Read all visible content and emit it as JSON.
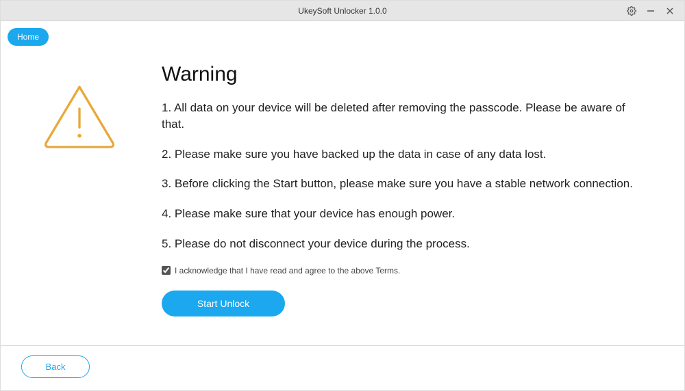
{
  "titlebar": {
    "title": "UkeySoft Unlocker 1.0.0"
  },
  "nav": {
    "home_label": "Home"
  },
  "content": {
    "heading": "Warning",
    "items": [
      "1. All data on your device will be deleted after removing the passcode. Please be aware of that.",
      "2. Please make sure you have backed up the data in case of any data lost.",
      "3. Before clicking the Start button, please make sure you have a stable network connection.",
      "4. Please make sure that your device has enough power.",
      "5. Please do not disconnect your device during the process."
    ],
    "terms_label": "I acknowledge that I have read and agree to the above Terms.",
    "start_label": "Start Unlock"
  },
  "footer": {
    "back_label": "Back"
  },
  "icons": {
    "settings": "settings-icon",
    "minimize": "minimize-icon",
    "close": "close-icon",
    "warning_triangle": "warning-triangle-icon"
  },
  "colors": {
    "accent": "#1ba8ef",
    "warning": "#e8a83a"
  }
}
